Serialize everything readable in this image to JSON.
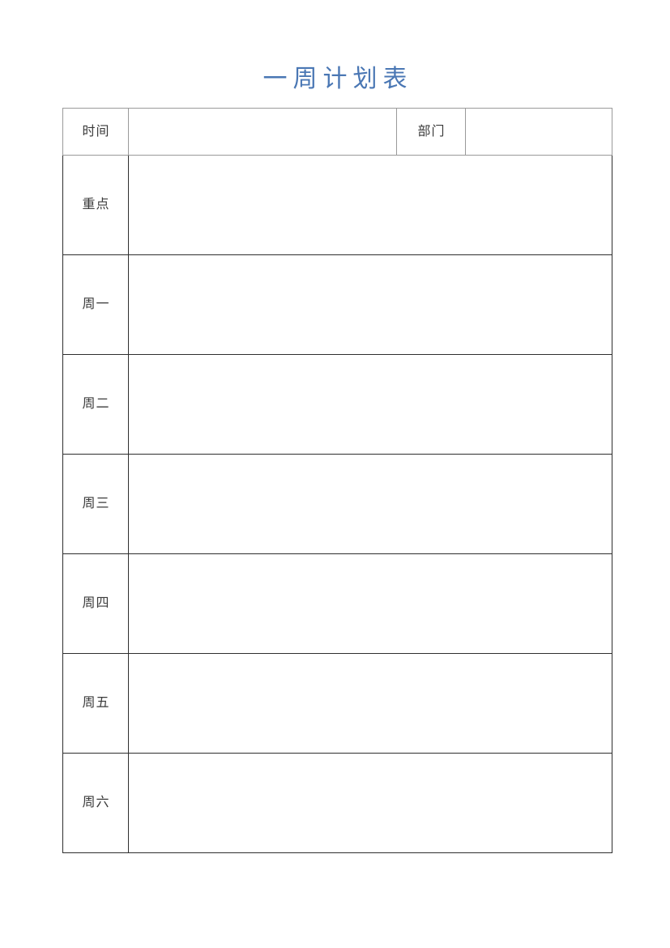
{
  "document": {
    "title": "一周计划表",
    "title_color": "#4a77b4",
    "page_background": "#ffffff"
  },
  "table": {
    "header_border_color": "#9a9a9a",
    "body_border_color": "#2e2e2e",
    "header": {
      "time_label": "时间",
      "time_value": "",
      "department_label": "部门",
      "department_value": ""
    },
    "rows": [
      {
        "label": "重点",
        "content": ""
      },
      {
        "label": "周一",
        "content": ""
      },
      {
        "label": "周二",
        "content": ""
      },
      {
        "label": "周三",
        "content": ""
      },
      {
        "label": "周四",
        "content": ""
      },
      {
        "label": "周五",
        "content": ""
      },
      {
        "label": "周六",
        "content": ""
      }
    ]
  }
}
